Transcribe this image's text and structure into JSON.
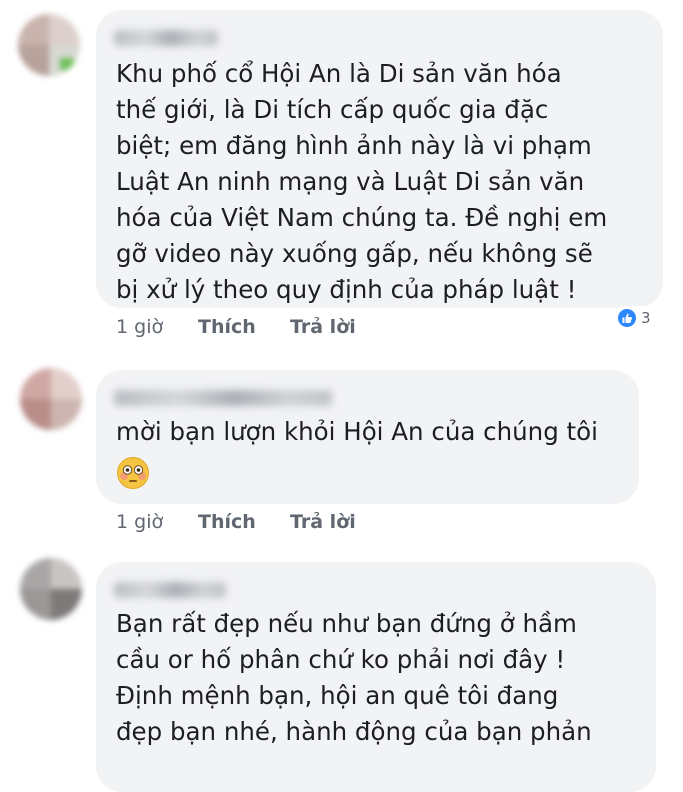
{
  "comments": [
    {
      "text": "Khu phố cổ Hội An là Di sản văn hóa\nthế giới, là Di tích cấp quốc gia đặc\nbiệt; em đăng hình ảnh này là vi phạm\nLuật An ninh mạng và Luật Di sản văn\nhóa của Việt Nam chúng ta. Đề nghị em\ngỡ video này xuống gấp, nếu không sẽ\nbị xử lý theo quy định của pháp luật !",
      "time": "1 giờ",
      "like_label": "Thích",
      "reply_label": "Trả lời",
      "reaction_count": "3",
      "reaction_icon": "like-icon"
    },
    {
      "text": "mời bạn lượn khỏi Hội An của chúng tôi",
      "emoji_icon": "flushed-face-icon",
      "time": "1 giờ",
      "like_label": "Thích",
      "reply_label": "Trả lời"
    },
    {
      "text": "Bạn rất đẹp nếu như bạn đứng ở hầm\ncầu or hố phân chứ ko phải nơi đây !\nĐịnh mệnh bạn, hội an quê tôi đang\nđẹp bạn nhé, hành động của bạn phản"
    }
  ],
  "colors": {
    "bubble": "#f2f3f5",
    "text": "#1c1e21",
    "action": "#606770",
    "like": "#2d88ff"
  }
}
